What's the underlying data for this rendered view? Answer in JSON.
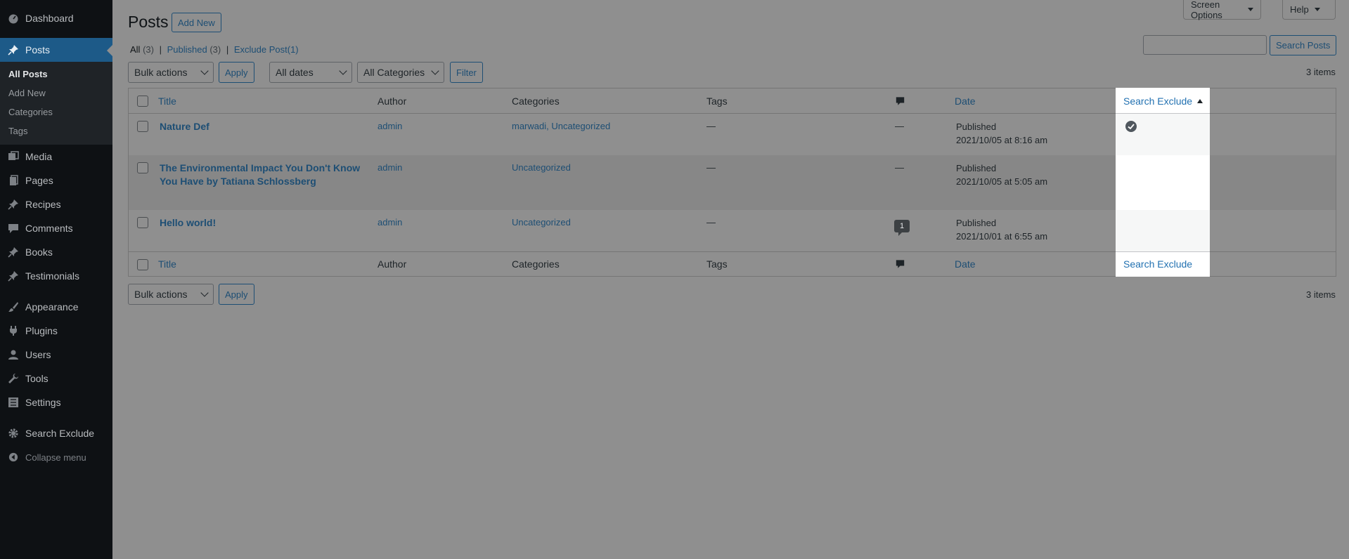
{
  "sidebar": {
    "dashboard": "Dashboard",
    "posts": "Posts",
    "submenu": [
      "All Posts",
      "Add New",
      "Categories",
      "Tags"
    ],
    "media": "Media",
    "pages": "Pages",
    "recipes": "Recipes",
    "comments": "Comments",
    "books": "Books",
    "testimonials": "Testimonials",
    "appearance": "Appearance",
    "plugins": "Plugins",
    "users": "Users",
    "tools": "Tools",
    "settings": "Settings",
    "search_exclude": "Search Exclude",
    "collapse": "Collapse menu"
  },
  "header": {
    "screen_options": "Screen Options",
    "help": "Help",
    "page_title": "Posts",
    "add_new": "Add New"
  },
  "filters": {
    "all": "All",
    "all_count": "(3)",
    "separator": "|",
    "published": "Published",
    "published_count": "(3)",
    "exclude": "Exclude Post(1)",
    "bulk_actions": "Bulk actions",
    "apply": "Apply",
    "all_dates": "All dates",
    "all_categories": "All Categories",
    "filter": "Filter",
    "search_placeholder": "",
    "search_button": "Search Posts",
    "items_count": "3 items"
  },
  "table": {
    "columns": {
      "title": "Title",
      "author": "Author",
      "categories": "Categories",
      "tags": "Tags",
      "date": "Date",
      "search_exclude": "Search Exclude"
    },
    "rows": [
      {
        "title": "Nature Def",
        "author": "admin",
        "categories": "marwadi, Uncategorized",
        "tags": "—",
        "comments": "—",
        "status": "Published",
        "date": "2021/10/05 at 8:16 am",
        "excluded": true
      },
      {
        "title_line1": "The Environmental Impact You Don't Know",
        "title_line2": "You Have by Tatiana Schlossberg",
        "author": "admin",
        "categories": "Uncategorized",
        "tags": "—",
        "comments": "—",
        "status": "Published",
        "date": "2021/10/05 at 5:05 am",
        "excluded": false
      },
      {
        "title": "Hello world!",
        "author": "admin",
        "categories": "Uncategorized",
        "tags": "—",
        "comments": "1",
        "status": "Published",
        "date": "2021/10/01 at 6:55 am",
        "excluded": false
      }
    ]
  },
  "colors": {
    "accent": "#2271b1",
    "overlay": "#8f8f8f",
    "sidebar_bg": "#0e1114",
    "active_menu": "#1d5a88"
  }
}
